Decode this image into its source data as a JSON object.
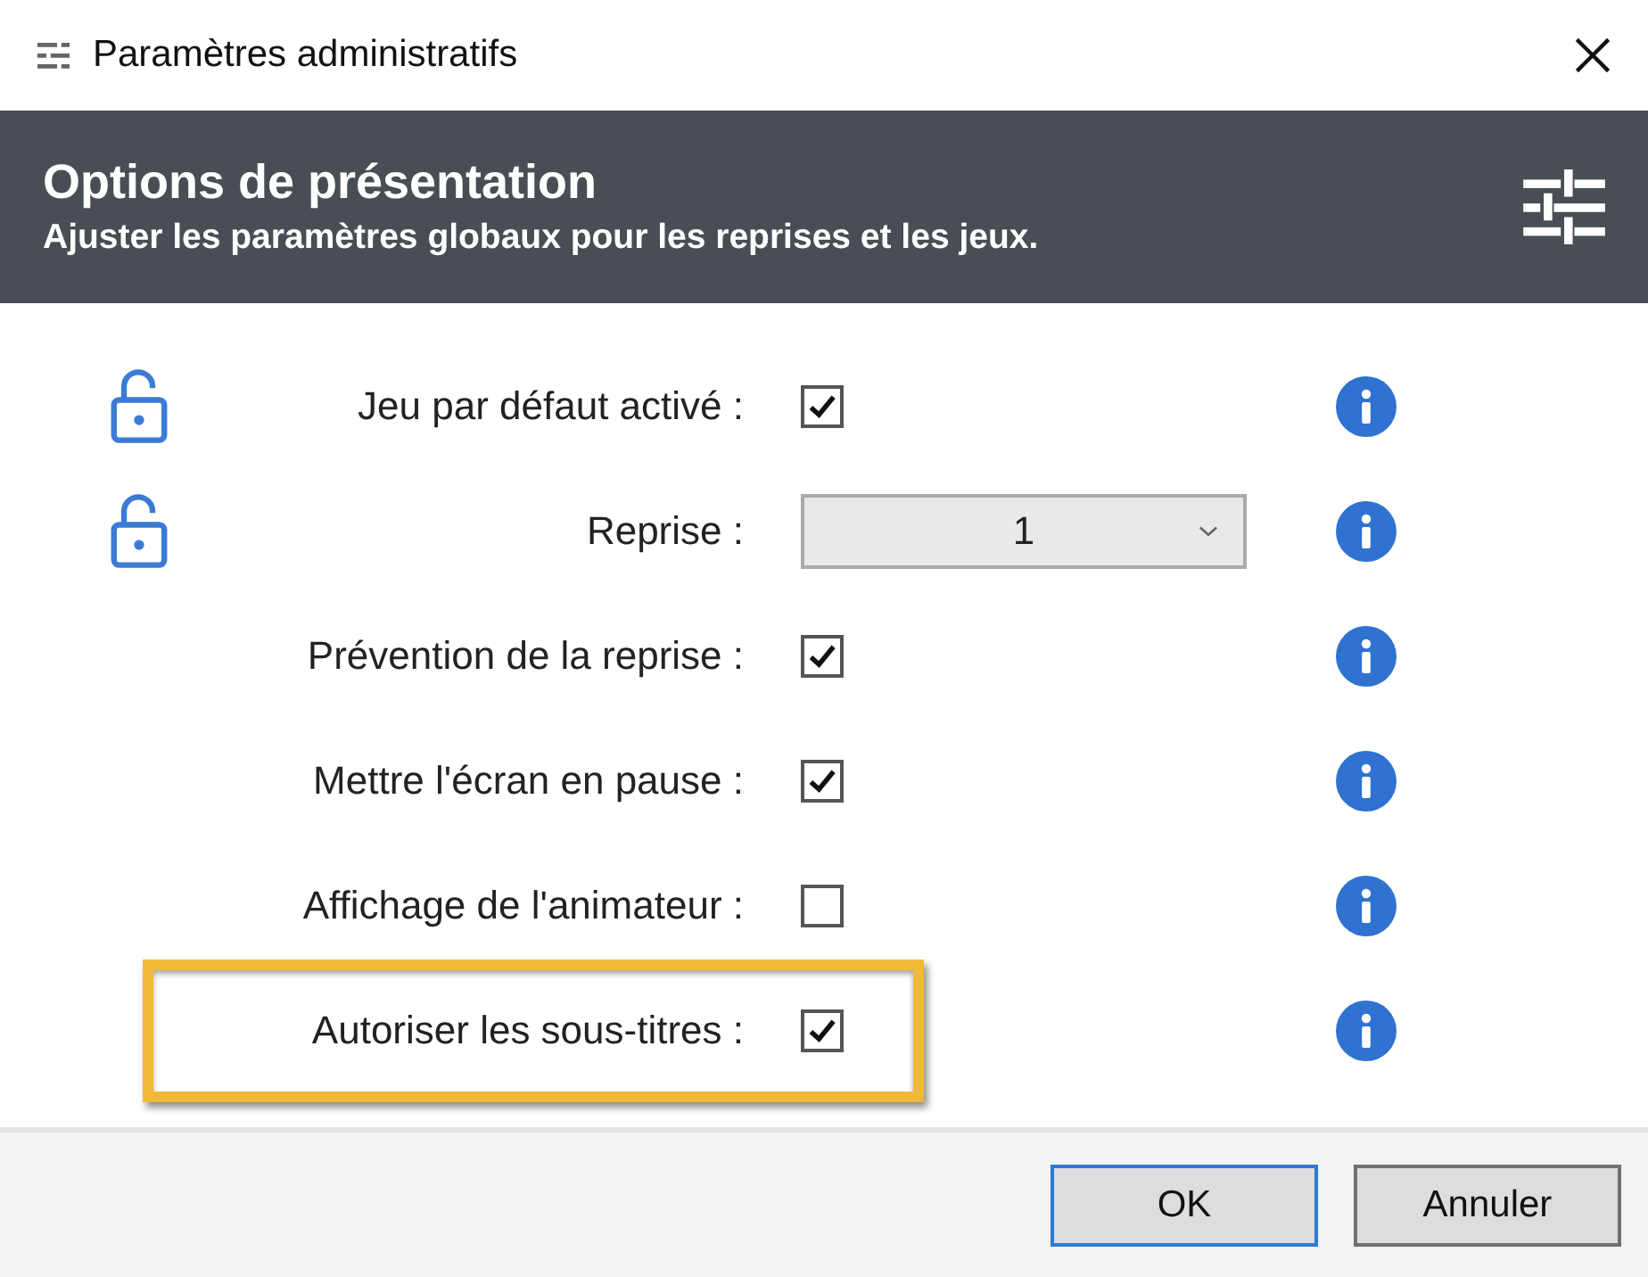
{
  "window": {
    "title": "Paramètres administratifs"
  },
  "header": {
    "title": "Options de présentation",
    "subtitle": "Ajuster les paramètres globaux pour les reprises et les jeux."
  },
  "settings": [
    {
      "label": "Jeu par défaut activé :",
      "kind": "checkbox",
      "checked": true,
      "locked": false,
      "highlighted": false
    },
    {
      "label": "Reprise :",
      "kind": "dropdown",
      "value": "1",
      "locked": false,
      "highlighted": false
    },
    {
      "label": "Prévention de la reprise :",
      "kind": "checkbox",
      "checked": true,
      "highlighted": false
    },
    {
      "label": "Mettre l'écran en pause :",
      "kind": "checkbox",
      "checked": true,
      "highlighted": false
    },
    {
      "label": "Affichage de l'animateur :",
      "kind": "checkbox",
      "checked": false,
      "highlighted": false
    },
    {
      "label": "Autoriser les sous-titres :",
      "kind": "checkbox",
      "checked": true,
      "highlighted": true
    }
  ],
  "buttons": [
    {
      "label": "OK",
      "default": true
    },
    {
      "label": "Annuler",
      "default": false
    }
  ]
}
